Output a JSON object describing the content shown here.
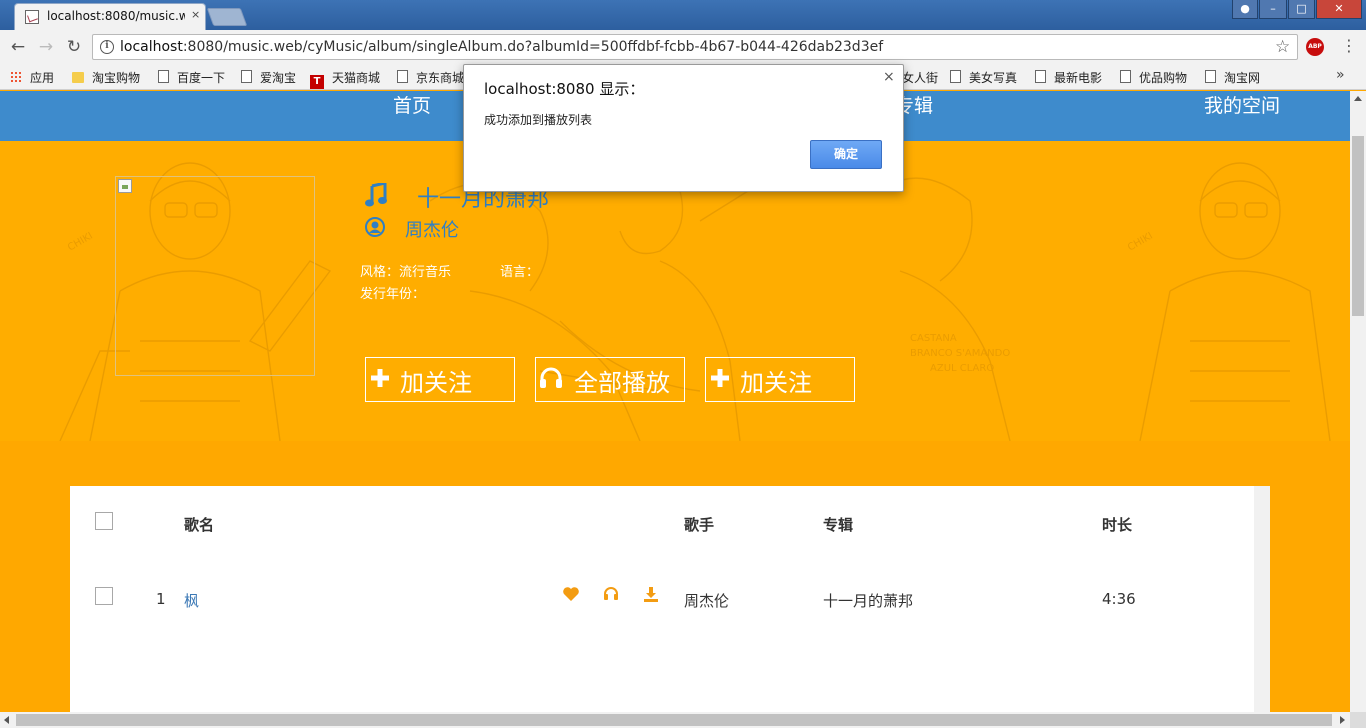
{
  "browser": {
    "tab_title": "localhost:8080/music.w",
    "tab_close": "×",
    "url_host": "localhost",
    "url_rest": ":8080/music.web/cyMusic/album/singleAlbum.do?albumId=500ffdbf-fcbb-4b67-b044-426dab23d3ef",
    "abp_label": "ABP",
    "bookmarks": [
      "应用",
      "淘宝购物",
      "百度一下",
      "爱淘宝",
      "天猫商城",
      "京东商城",
      "女人街",
      "美女写真",
      "最新电影",
      "优品购物",
      "淘宝网"
    ],
    "tmall_glyph": "T",
    "overflow": "»"
  },
  "nav": {
    "items": [
      "首页",
      "专辑",
      "我的空间"
    ]
  },
  "album": {
    "title": "十一月的萧邦",
    "artist": "周杰伦",
    "style_label": "风格：流行音乐",
    "language_label": "语言：",
    "year_label": "发行年份："
  },
  "buttons": {
    "follow": "加关注",
    "play_all": "全部播放",
    "follow2": "加关注"
  },
  "song_table": {
    "headers": {
      "name": "歌名",
      "singer": "歌手",
      "album": "专辑",
      "duration": "时长"
    },
    "rows": [
      {
        "index": "1",
        "name": "枫",
        "singer": "周杰伦",
        "album": "十一月的萧邦",
        "duration": "4:36"
      }
    ]
  },
  "dialog": {
    "title": "localhost:8080 显示：",
    "message": "成功添加到播放列表",
    "ok": "确定",
    "close": "×"
  },
  "colors": {
    "navbar": "#3e8bcc",
    "hero": "#ffad00",
    "accent_icon": "#f39c12",
    "link": "#2f7fc4"
  }
}
